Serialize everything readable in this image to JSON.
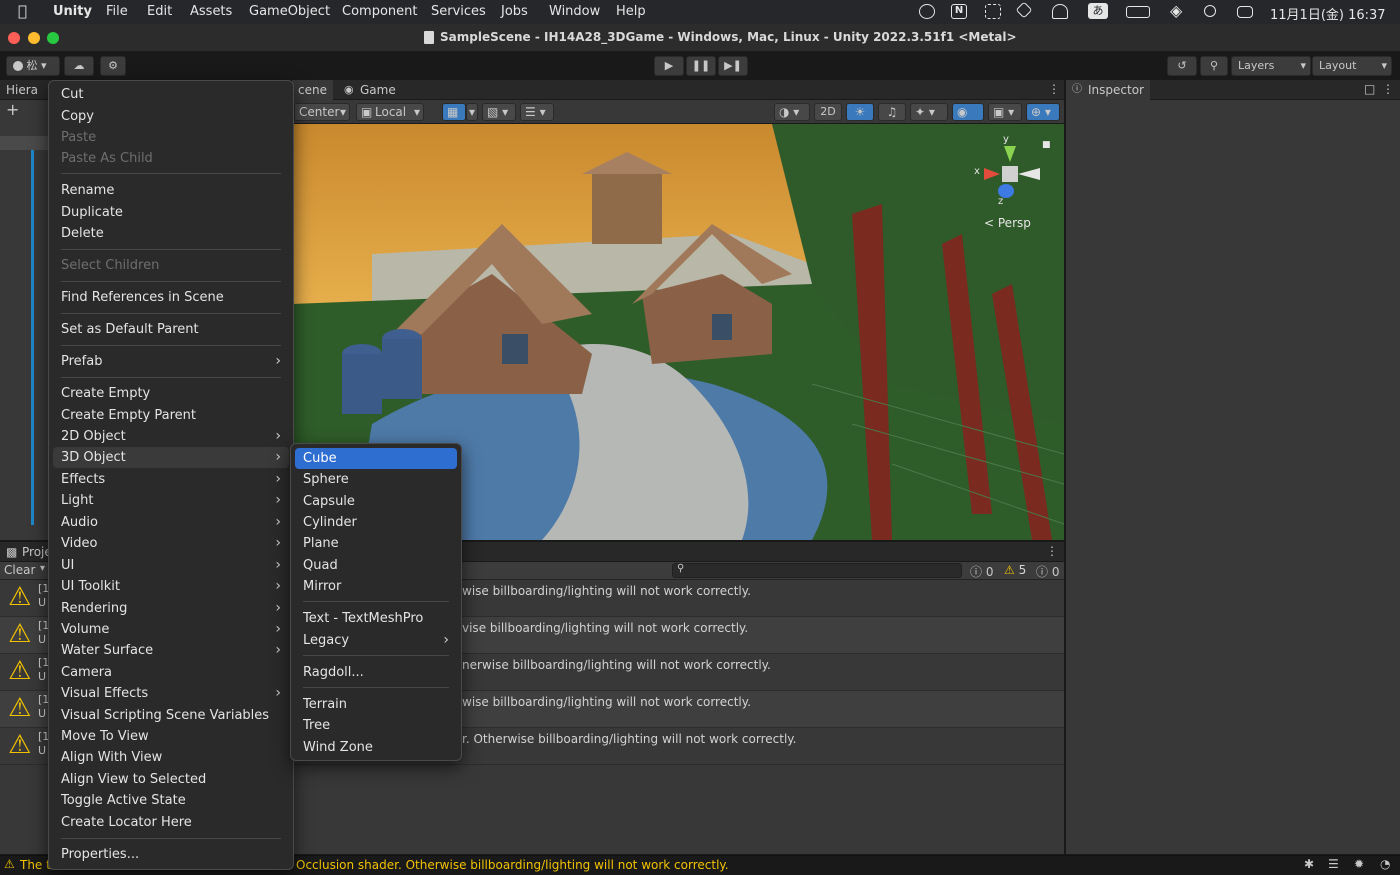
{
  "menubar": {
    "app_name": "Unity",
    "items": [
      "File",
      "Edit",
      "Assets",
      "GameObject",
      "Component",
      "Services",
      "Jobs",
      "Window",
      "Help"
    ],
    "ime": "あ",
    "datetime": "11月1日(金) 16:37"
  },
  "window": {
    "title": "SampleScene - IH14A28_3DGame - Windows, Mac, Linux - Unity 2022.3.51f1 <Metal>"
  },
  "toolbar": {
    "account_label": "松",
    "layers_label": "Layers",
    "layout_label": "Layout"
  },
  "hierarchy": {
    "tab_label": "Hiera"
  },
  "scene_tabs": {
    "scene_label": "cene",
    "game_label": "Game"
  },
  "scene_toolbar": {
    "pivot_label": "Center",
    "space_label": "Local",
    "mode_2d_label": "2D"
  },
  "gizmo": {
    "y_label": "y",
    "x_label": "x",
    "z_label": "z",
    "persp_label": "Persp"
  },
  "inspector": {
    "tab_label": "Inspector"
  },
  "project": {
    "tab_label": "Proje",
    "clear_label": "Clear"
  },
  "console": {
    "info_count": "0",
    "warn_count": "5",
    "error_count": "0",
    "rows": [
      {
        "prefix": "[1",
        "prefix2": "U",
        "text": "wise billboarding/lighting will not work correctly."
      },
      {
        "prefix": "[1",
        "prefix2": "U",
        "text": "vise billboarding/lighting will not work correctly."
      },
      {
        "prefix": "[1",
        "prefix2": "U",
        "text": "nerwise billboarding/lighting will not work correctly."
      },
      {
        "prefix": "[1",
        "prefix2": "U",
        "text": "wise billboarding/lighting will not work correctly."
      },
      {
        "prefix": "[1",
        "prefix2": "U",
        "text": "r. Otherwise billboarding/lighting will not work correctly."
      }
    ]
  },
  "statusbar": {
    "left_text": "The t",
    "message": "Occlusion shader. Otherwise billboarding/lighting will not work correctly."
  },
  "context_menu": {
    "items": [
      {
        "label": "Cut"
      },
      {
        "label": "Copy"
      },
      {
        "label": "Paste"
      },
      {
        "label": "Paste As Child"
      },
      {
        "label": "Rename"
      },
      {
        "label": "Duplicate"
      },
      {
        "label": "Delete"
      },
      {
        "label": "Select Children"
      },
      {
        "label": "Find References in Scene"
      },
      {
        "label": "Set as Default Parent"
      },
      {
        "label": "Prefab"
      },
      {
        "label": "Create Empty"
      },
      {
        "label": "Create Empty Parent"
      },
      {
        "label": "2D Object"
      },
      {
        "label": "3D Object"
      },
      {
        "label": "Effects"
      },
      {
        "label": "Light"
      },
      {
        "label": "Audio"
      },
      {
        "label": "Video"
      },
      {
        "label": "UI"
      },
      {
        "label": "UI Toolkit"
      },
      {
        "label": "Rendering"
      },
      {
        "label": "Volume"
      },
      {
        "label": "Water Surface"
      },
      {
        "label": "Camera"
      },
      {
        "label": "Visual Effects"
      },
      {
        "label": "Visual Scripting Scene Variables"
      },
      {
        "label": "Move To View"
      },
      {
        "label": "Align With View"
      },
      {
        "label": "Align View to Selected"
      },
      {
        "label": "Toggle Active State"
      },
      {
        "label": "Create Locator Here"
      },
      {
        "label": "Properties..."
      }
    ]
  },
  "submenu_3d": {
    "items": [
      {
        "label": "Cube"
      },
      {
        "label": "Sphere"
      },
      {
        "label": "Capsule"
      },
      {
        "label": "Cylinder"
      },
      {
        "label": "Plane"
      },
      {
        "label": "Quad"
      },
      {
        "label": "Mirror"
      },
      {
        "label": "Text - TextMeshPro"
      },
      {
        "label": "Legacy"
      },
      {
        "label": "Ragdoll..."
      },
      {
        "label": "Terrain"
      },
      {
        "label": "Tree"
      },
      {
        "label": "Wind Zone"
      }
    ]
  },
  "colors": {
    "selection": "#2f6ed1",
    "warning": "#f2c200",
    "play_accent": "#3a79bb"
  }
}
